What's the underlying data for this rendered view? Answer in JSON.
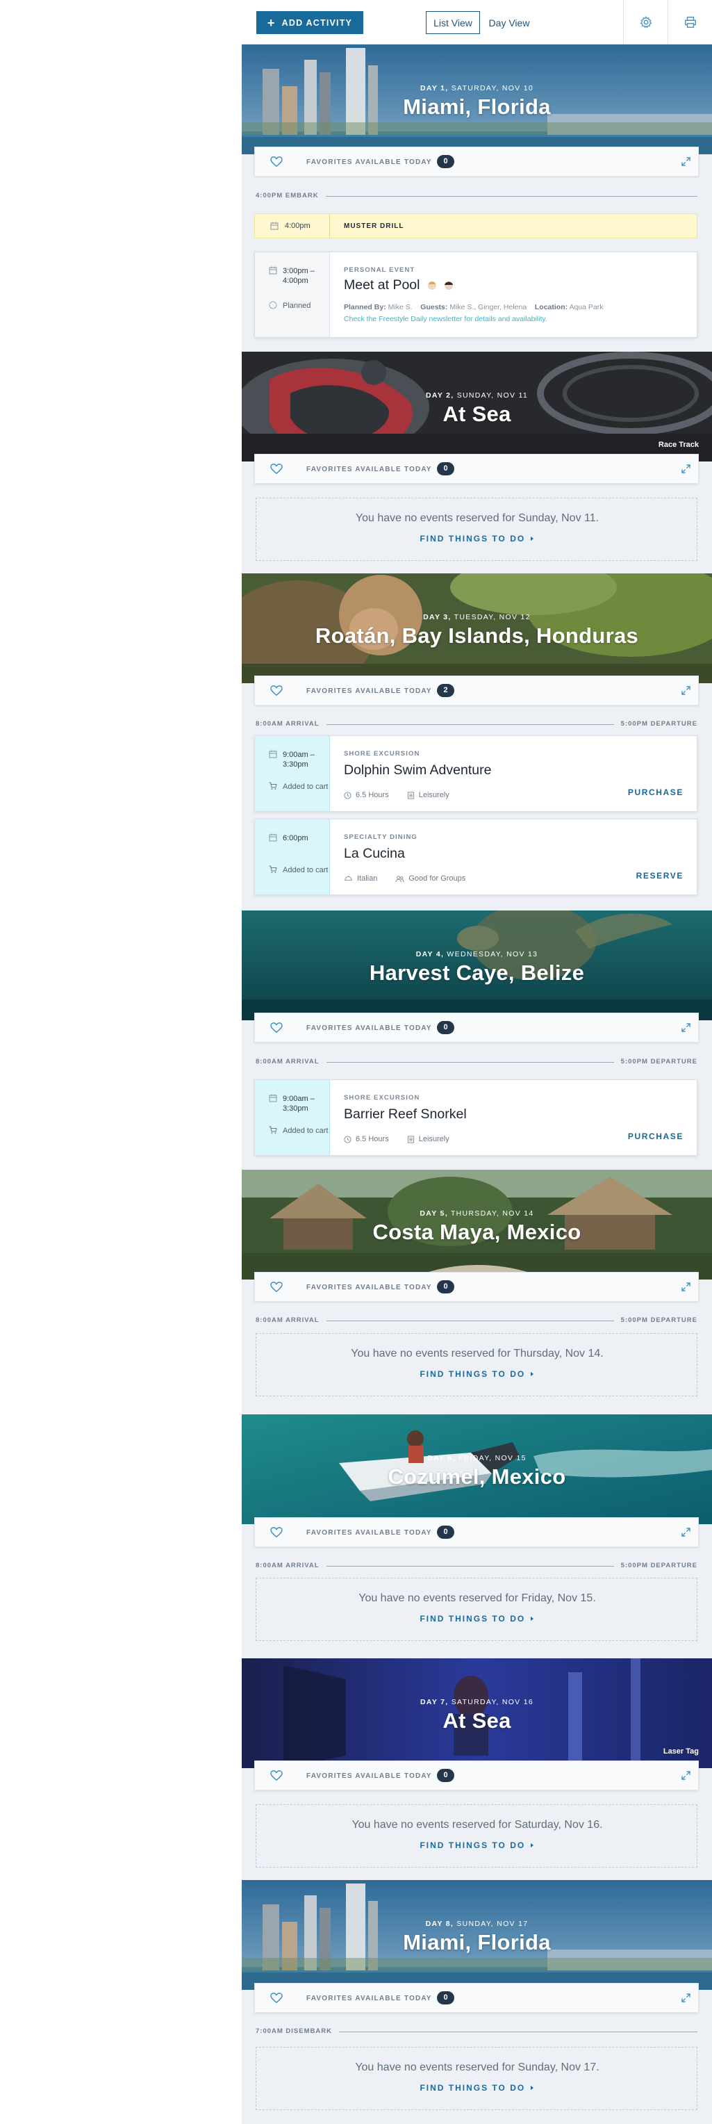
{
  "toolbar": {
    "add_activity": "ADD ACTIVITY",
    "list_view": "List View",
    "day_view": "Day View",
    "settings_icon": "gear-icon",
    "print_icon": "printer-icon"
  },
  "colors": {
    "primary": "#176a9a",
    "badge": "#23364a",
    "booked_bg": "#d9f6fb",
    "drill_bg": "#fff8cf",
    "note": "#3fb3c6"
  },
  "favorites_label": "FAVORITES AVAILABLE TODAY",
  "days": [
    {
      "subtitle_strong": "DAY 1,",
      "subtitle_rest": " SATURDAY, NOV 10",
      "title": "Miami, Florida",
      "favorites_count": "0",
      "timeline_left": "4:00PM EMBARK",
      "muster": {
        "time": "4:00pm",
        "label": "MUSTER DRILL"
      },
      "event": {
        "time": "3:00pm – 4:00pm",
        "status": "Planned",
        "category": "PERSONAL EVENT",
        "name": "Meet at Pool",
        "planned_by_label": "Planned By:",
        "planned_by": "Mike S.",
        "guests_label": "Guests:",
        "guests": "Mike S., Ginger, Helena",
        "location_label": "Location:",
        "location": "Aqua Park",
        "note": "Check the Freestyle Daily newsletter for details and availability."
      }
    },
    {
      "subtitle_strong": "DAY 2,",
      "subtitle_rest": " SUNDAY, NOV 11",
      "title": "At Sea",
      "caption": "Race Track",
      "favorites_count": "0",
      "empty": {
        "msg": "You have no events reserved for Sunday, Nov 11.",
        "find": "FIND THINGS TO DO"
      }
    },
    {
      "subtitle_strong": "DAY 3,",
      "subtitle_rest": " TUESDAY, NOV 12",
      "title": "Roatán, Bay Islands, Honduras",
      "favorites_count": "2",
      "timeline_left": "8:00AM ARRIVAL",
      "timeline_right": "5:00PM DEPARTURE",
      "events": [
        {
          "time": "9:00am – 3:30pm",
          "status": "Added to cart",
          "category": "SHORE EXCURSION",
          "name": "Dolphin Swim Adventure",
          "meta1": "6.5 Hours",
          "meta2": "Leisurely",
          "action": "PURCHASE"
        },
        {
          "time": "6:00pm",
          "status": "Added to cart",
          "category": "SPECIALTY DINING",
          "name": "La Cucina",
          "meta1": "Italian",
          "meta2": "Good for Groups",
          "action": "RESERVE"
        }
      ]
    },
    {
      "subtitle_strong": "DAY 4,",
      "subtitle_rest": " WEDNESDAY, NOV 13",
      "title": "Harvest Caye, Belize",
      "favorites_count": "0",
      "timeline_left": "8:00AM ARRIVAL",
      "timeline_right": "5:00PM DEPARTURE",
      "event": {
        "time": "9:00am – 3:30pm",
        "status": "Added to cart",
        "category": "SHORE EXCURSION",
        "name": "Barrier Reef Snorkel",
        "meta1": "6.5 Hours",
        "meta2": "Leisurely",
        "action": "PURCHASE"
      }
    },
    {
      "subtitle_strong": "DAY 5,",
      "subtitle_rest": " THURSDAY, NOV 14",
      "title": "Costa Maya, Mexico",
      "favorites_count": "0",
      "timeline_left": "8:00AM ARRIVAL",
      "timeline_right": "5:00PM DEPARTURE",
      "empty": {
        "msg": "You have no events reserved for Thursday, Nov 14.",
        "find": "FIND THINGS TO DO"
      }
    },
    {
      "subtitle_strong": "DAY 6,",
      "subtitle_rest": " FRIDAY, NOV 15",
      "title": "Cozumel, Mexico",
      "favorites_count": "0",
      "timeline_left": "8:00AM ARRIVAL",
      "timeline_right": "5:00PM DEPARTURE",
      "empty": {
        "msg": "You have no events reserved for Friday, Nov 15.",
        "find": "FIND THINGS TO DO"
      }
    },
    {
      "subtitle_strong": "DAY 7,",
      "subtitle_rest": " SATURDAY, NOV 16",
      "title": "At Sea",
      "caption": "Laser Tag",
      "favorites_count": "0",
      "empty": {
        "msg": "You have no events reserved for Saturday, Nov 16.",
        "find": "FIND THINGS TO DO"
      }
    },
    {
      "subtitle_strong": "DAY 8,",
      "subtitle_rest": " SUNDAY, NOV 17",
      "title": "Miami, Florida",
      "favorites_count": "0",
      "timeline_left": "7:00AM DISEMBARK",
      "empty": {
        "msg": "You have no events reserved for Sunday, Nov 17.",
        "find": "FIND THINGS TO DO"
      }
    }
  ]
}
